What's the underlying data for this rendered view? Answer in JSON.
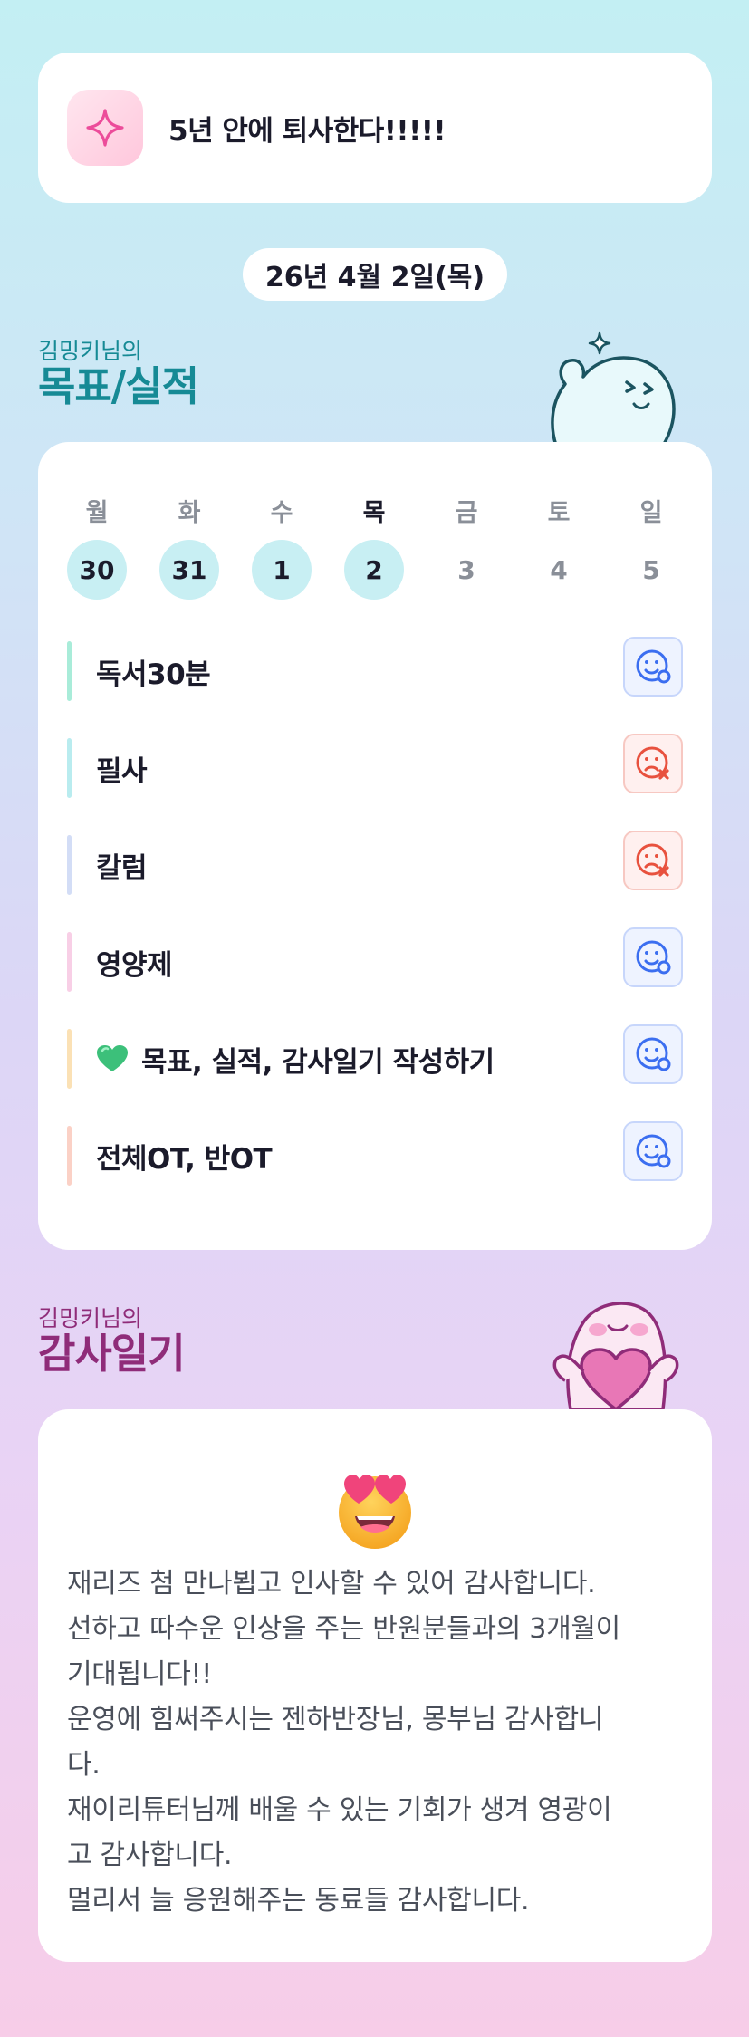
{
  "goal": {
    "text": "5년 안에 퇴사한다!!!!!"
  },
  "date": "26년 4월 2일(목)",
  "goals_section": {
    "subtitle": "김밍키님의",
    "title": "목표/실적"
  },
  "week": [
    {
      "weekday": "월",
      "day": "30",
      "state": "done"
    },
    {
      "weekday": "화",
      "day": "31",
      "state": "done"
    },
    {
      "weekday": "수",
      "day": "1",
      "state": "done"
    },
    {
      "weekday": "목",
      "day": "2",
      "state": "today"
    },
    {
      "weekday": "금",
      "day": "3",
      "state": "future"
    },
    {
      "weekday": "토",
      "day": "4",
      "state": "future"
    },
    {
      "weekday": "일",
      "day": "5",
      "state": "future"
    }
  ],
  "tasks": [
    {
      "label": "독서30분",
      "status": "success",
      "bar_color": "#a9ecd9"
    },
    {
      "label": "필사",
      "status": "fail",
      "bar_color": "#b9ecef"
    },
    {
      "label": "칼럼",
      "status": "fail",
      "bar_color": "#d3ddf6"
    },
    {
      "label": "영양제",
      "status": "success",
      "bar_color": "#f8cfe6"
    },
    {
      "label": "목표, 실적, 감사일기 작성하기",
      "status": "success",
      "bar_color": "#fbe1b5",
      "icon": "green-heart-icon"
    },
    {
      "label": "전체OT, 반OT",
      "status": "success",
      "bar_color": "#fbd1c6"
    }
  ],
  "gratitude_section": {
    "subtitle": "김밍키님의",
    "title": "감사일기"
  },
  "gratitude": {
    "emoji": "heart-eyes-emoji",
    "lines": [
      "재리즈 첨 만나뵙고 인사할 수 있어 감사합니다.",
      "선하고 따수운 인상을 주는 반원분들과의 3개월이",
      "기대됩니다!!",
      "운영에 힘써주시는 젠하반장님, 몽부님 감사합니",
      "다.",
      "재이리튜터님께 배울 수 있는 기회가 생겨 영광이",
      "고 감사합니다.",
      "멀리서 늘 응원해주는 동료들 감사합니다."
    ]
  },
  "colors": {
    "success": "#3b6ef0",
    "fail": "#e8513e",
    "goal_title": "#168a95",
    "gratitude_title": "#8f2c79"
  }
}
